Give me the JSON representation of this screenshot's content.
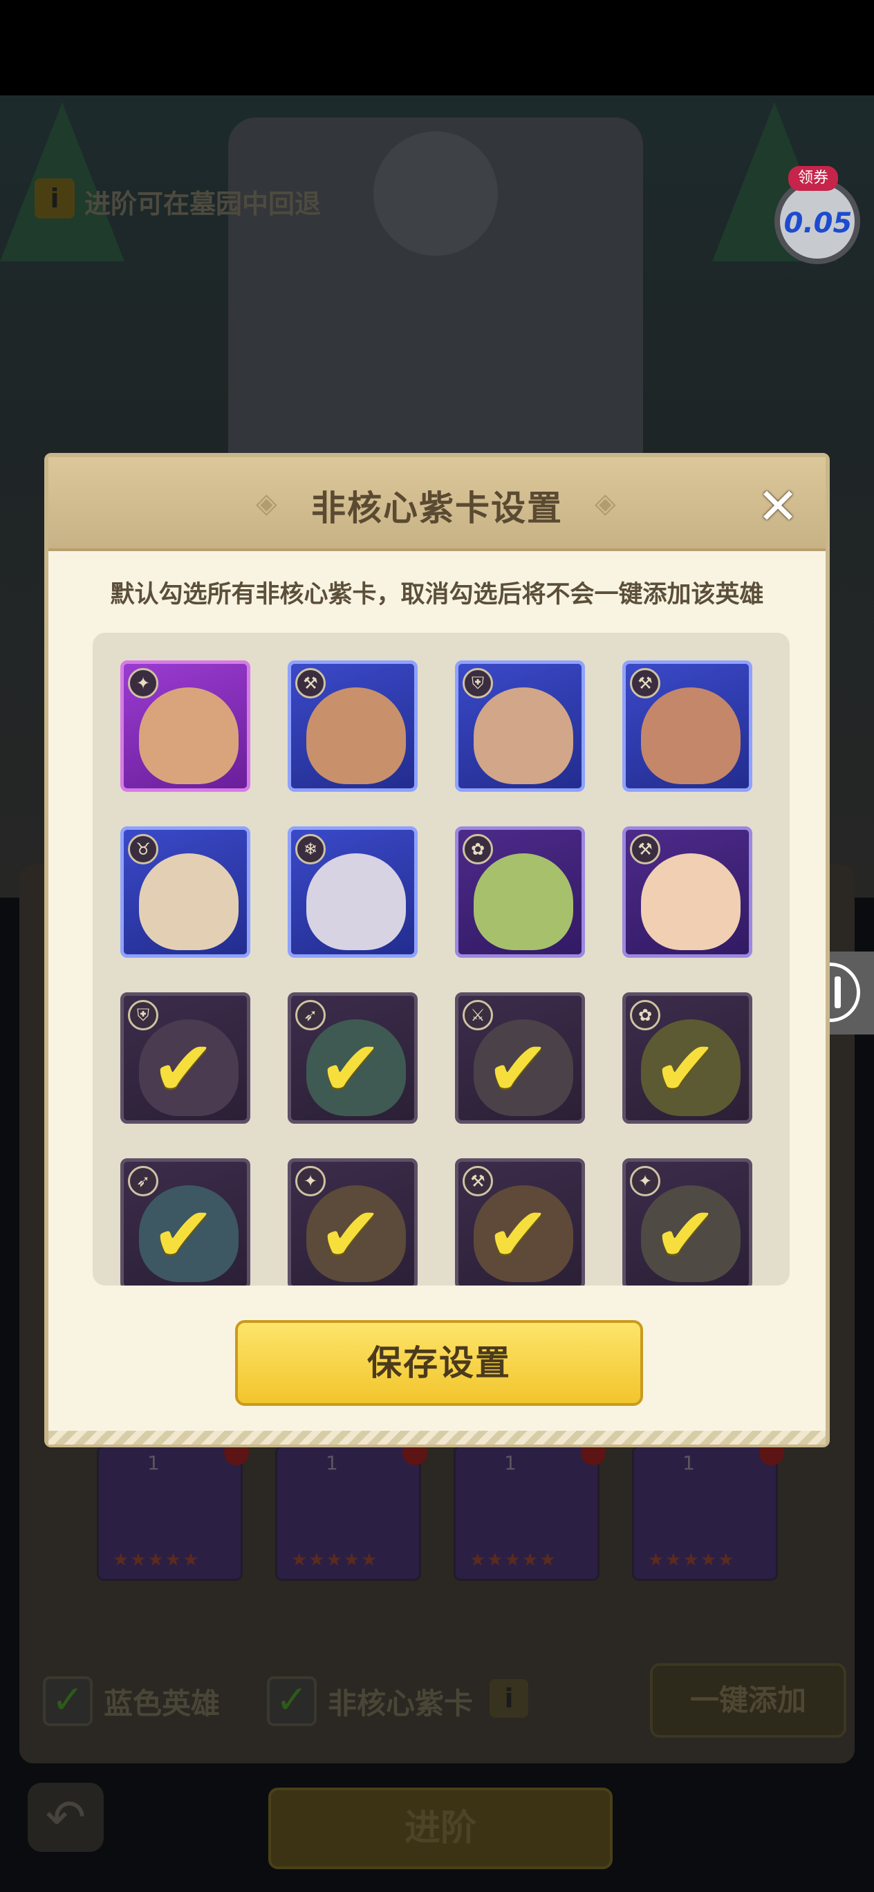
{
  "background": {
    "hint_text": "进阶可在墓园中回退",
    "coupon_badge": "领券",
    "coupon_value": "0.05",
    "option_blue_label": "蓝色英雄",
    "option_noncore_label": "非核心紫卡",
    "add_all_label": "一键添加",
    "advance_label": "进阶",
    "hero_level": "1"
  },
  "modal": {
    "title": "非核心紫卡设置",
    "description": "默认勾选所有非核心紫卡，取消勾选后将不会一键添加该英雄",
    "save_label": "保存设置",
    "close_icon": "close-icon"
  },
  "heroes": [
    {
      "frame": "purple",
      "class_icon": "mage-icon",
      "checked": false,
      "face": "#d9a47c"
    },
    {
      "frame": "blue",
      "class_icon": "axe-icon",
      "checked": false,
      "face": "#c8916c"
    },
    {
      "frame": "blue",
      "class_icon": "shield-icon",
      "checked": false,
      "face": "#d1a689"
    },
    {
      "frame": "blue",
      "class_icon": "axe-icon",
      "checked": false,
      "face": "#c5876a"
    },
    {
      "frame": "blue",
      "class_icon": "horn-icon",
      "checked": false,
      "face": "#e3d0b4"
    },
    {
      "frame": "blue",
      "class_icon": "frost-icon",
      "checked": false,
      "face": "#d7d3e2"
    },
    {
      "frame": "violet",
      "class_icon": "paw-icon",
      "checked": false,
      "face": "#a7c06b"
    },
    {
      "frame": "violet",
      "class_icon": "axe-icon",
      "checked": false,
      "face": "#f0cfb3"
    },
    {
      "frame": "dimmed",
      "class_icon": "shield-icon",
      "checked": true,
      "face": "#4a3b50"
    },
    {
      "frame": "dimmed",
      "class_icon": "bow-icon",
      "checked": true,
      "face": "#3f5a52"
    },
    {
      "frame": "dimmed",
      "class_icon": "blade-icon",
      "checked": true,
      "face": "#4a4248"
    },
    {
      "frame": "dimmed",
      "class_icon": "paw-icon",
      "checked": true,
      "face": "#5c5a33"
    },
    {
      "frame": "dimmed",
      "class_icon": "bow-icon",
      "checked": true,
      "face": "#3d5863"
    },
    {
      "frame": "dimmed",
      "class_icon": "mage-icon",
      "checked": true,
      "face": "#5c4a3a"
    },
    {
      "frame": "dimmed",
      "class_icon": "axe-icon",
      "checked": true,
      "face": "#5f4a3a"
    },
    {
      "frame": "dimmed",
      "class_icon": "mage-icon",
      "checked": true,
      "face": "#4f4a44"
    }
  ]
}
